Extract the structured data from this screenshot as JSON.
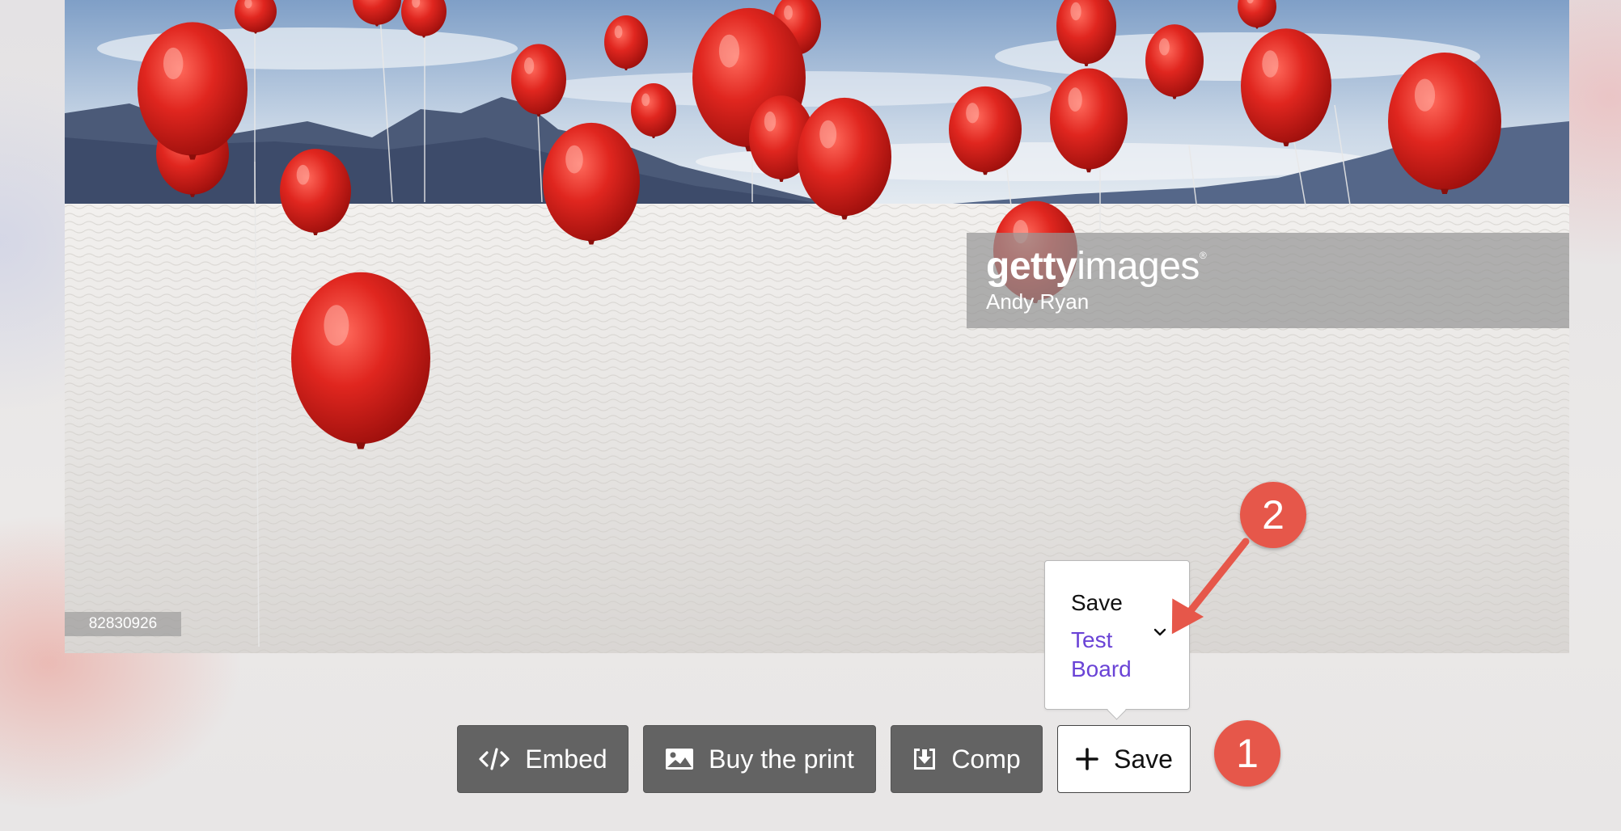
{
  "image": {
    "id_label": "82830926",
    "watermark_brand_bold": "getty",
    "watermark_brand_light": "images",
    "watermark_registered": "®",
    "watermark_credit": "Andy Ryan"
  },
  "save_popover": {
    "title": "Save",
    "board_name": "Test Board",
    "chevron_icon": "chevron-down-icon"
  },
  "actions": {
    "embed": {
      "label": "Embed",
      "icon": "code-icon"
    },
    "buy_print": {
      "label": "Buy the print",
      "icon": "image-icon"
    },
    "comp": {
      "label": "Comp",
      "icon": "download-icon"
    },
    "save": {
      "label": "Save",
      "icon": "plus-icon"
    }
  },
  "callouts": {
    "step_1": "1",
    "step_2": "2",
    "color": "#e6574a"
  },
  "colors": {
    "button_dark": "#636363",
    "board_link": "#6a43d6",
    "balloon_red": "#d42420"
  }
}
